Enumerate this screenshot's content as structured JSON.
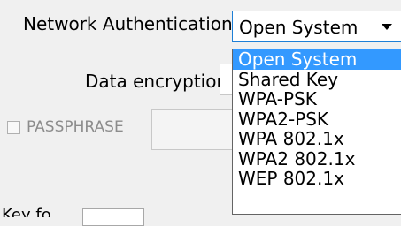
{
  "network_authentication": {
    "label": "Network Authentication:",
    "selected": "Open System",
    "options": [
      "Open System",
      "Shared Key",
      "WPA-PSK",
      "WPA2-PSK",
      "WPA 802.1x",
      "WPA2 802.1x",
      "WEP 802.1x"
    ]
  },
  "data_encryption": {
    "label": "Data encryption:"
  },
  "passphrase": {
    "label": "PASSPHRASE"
  },
  "bottom": {
    "label_partial": "Key fo"
  }
}
